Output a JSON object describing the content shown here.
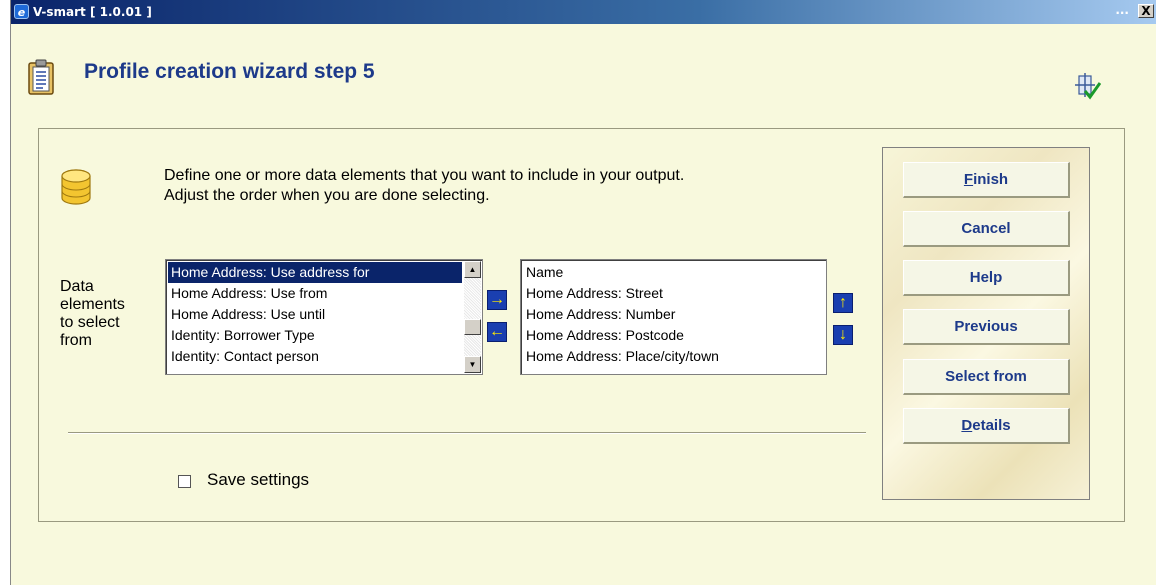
{
  "window": {
    "title": "V-smart [ 1.0.01 ]",
    "controls_dots": "...",
    "close_glyph": "X"
  },
  "header": {
    "title": "Profile creation wizard step 5"
  },
  "instructions": {
    "line1": "Define one or more data elements that you want to include in your output.",
    "line2": "Adjust the order when you are done selecting."
  },
  "data_elements_label": [
    "Data",
    "elements",
    "to select",
    "from"
  ],
  "available_list": {
    "items": [
      "Home Address: Use address for",
      "Home Address: Use from",
      "Home Address: Use until",
      "Identity: Borrower Type",
      "Identity: Contact person"
    ],
    "selected_index": 0
  },
  "selected_list": {
    "items": [
      "Name",
      "Home Address: Street",
      "Home Address: Number",
      "Home Address: Postcode",
      "Home Address: Place/city/town"
    ]
  },
  "transfer_buttons": {
    "add": "→",
    "remove": "←",
    "move_up": "↑",
    "move_down": "↓"
  },
  "save_settings": {
    "label": "Save settings",
    "checked": false
  },
  "actions": {
    "finish": {
      "first": "F",
      "rest": "inish"
    },
    "cancel": "Cancel",
    "help": "Help",
    "previous": "Previous",
    "select_from": "Select from",
    "details": {
      "first": "D",
      "rest": "etails"
    }
  },
  "icons": {
    "app": "ie-icon",
    "header": "clipboard-icon",
    "wizard": "wizard-check-icon",
    "data": "database-icon"
  }
}
